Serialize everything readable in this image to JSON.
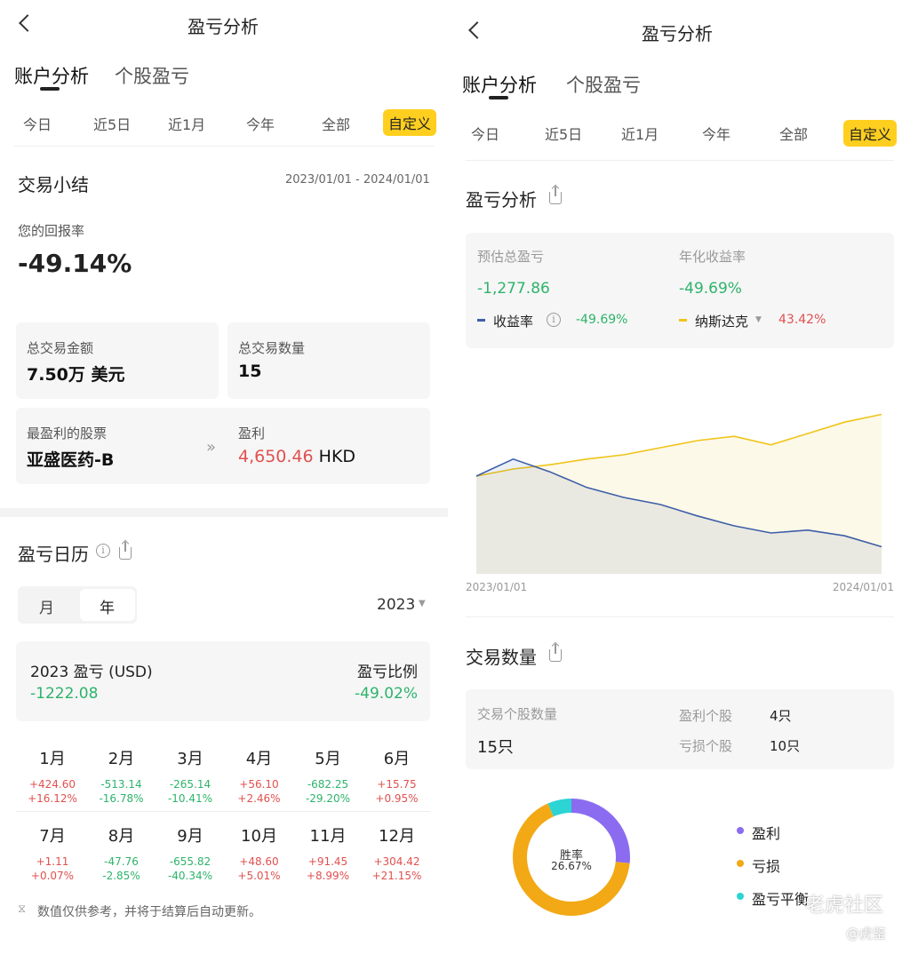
{
  "left": {
    "title": "盈亏分析",
    "tabs": [
      "账户分析",
      "个股盈亏"
    ],
    "periods": [
      "今日",
      "近5日",
      "近1月",
      "今年",
      "全部",
      "自定义"
    ],
    "summary": {
      "heading": "交易小结",
      "date_range": "2023/01/01 - 2024/01/01",
      "return_label": "您的回报率",
      "return_value": "-49.14%",
      "total_amount_label": "总交易金额",
      "total_amount_value": "7.50万 美元",
      "total_count_label": "总交易数量",
      "total_count_value": "15",
      "best_stock_label": "最盈利的股票",
      "best_stock_value": "亚盛医药-B",
      "profit_label": "盈利",
      "profit_value": "4,650.46",
      "profit_currency": "HKD"
    },
    "calendar": {
      "heading": "盈亏日历",
      "mode_month": "月",
      "mode_year": "年",
      "year": "2023",
      "pl_label": "2023 盈亏 (USD)",
      "pl_value": "-1222.08",
      "ratio_label": "盈亏比例",
      "ratio_value": "-49.02%",
      "months": [
        {
          "m": "1月",
          "v1": "+424.60",
          "v2": "+16.12%",
          "c": "red"
        },
        {
          "m": "2月",
          "v1": "-513.14",
          "v2": "-16.78%",
          "c": "green"
        },
        {
          "m": "3月",
          "v1": "-265.14",
          "v2": "-10.41%",
          "c": "green"
        },
        {
          "m": "4月",
          "v1": "+56.10",
          "v2": "+2.46%",
          "c": "red"
        },
        {
          "m": "5月",
          "v1": "-682.25",
          "v2": "-29.20%",
          "c": "green"
        },
        {
          "m": "6月",
          "v1": "+15.75",
          "v2": "+0.95%",
          "c": "red"
        },
        {
          "m": "7月",
          "v1": "+1.11",
          "v2": "+0.07%",
          "c": "red"
        },
        {
          "m": "8月",
          "v1": "-47.76",
          "v2": "-2.85%",
          "c": "green"
        },
        {
          "m": "9月",
          "v1": "-655.82",
          "v2": "-40.34%",
          "c": "green"
        },
        {
          "m": "10月",
          "v1": "+48.60",
          "v2": "+5.01%",
          "c": "red"
        },
        {
          "m": "11月",
          "v1": "+91.45",
          "v2": "+8.99%",
          "c": "red"
        },
        {
          "m": "12月",
          "v1": "+304.42",
          "v2": "+21.15%",
          "c": "red"
        }
      ],
      "note": "数值仅供参考，并将于结算后自动更新。"
    }
  },
  "right": {
    "title": "盈亏分析",
    "tabs": [
      "账户分析",
      "个股盈亏"
    ],
    "periods": [
      "今日",
      "近5日",
      "近1月",
      "今年",
      "全部",
      "自定义"
    ],
    "pl_section": {
      "heading": "盈亏分析",
      "est_label": "预估总盈亏",
      "est_value": "-1,277.86",
      "annual_label": "年化收益率",
      "annual_value": "-49.69%",
      "series1_name": "收益率",
      "series1_value": "-49.69%",
      "series2_name": "纳斯达克",
      "series2_value": "43.42%",
      "x_start": "2023/01/01",
      "x_end": "2024/01/01"
    },
    "trades": {
      "heading": "交易数量",
      "count_label": "交易个股数量",
      "count_value": "15只",
      "profit_label": "盈利个股",
      "profit_value": "4只",
      "loss_label": "亏损个股",
      "loss_value": "10只",
      "donut_label": "胜率",
      "donut_value": "26.67%",
      "legend": [
        "盈利",
        "亏损",
        "盈亏平衡"
      ]
    },
    "watermark": "老虎社区",
    "watermark2": "@虎鉴"
  },
  "colors": {
    "accent_yellow": "#ffcf1f",
    "gain_red": "#e0514f",
    "loss_green": "#2eb36b",
    "series_blue": "#3d5ea8",
    "series_gold": "#f0c419",
    "donut_purple": "#8b6cf0",
    "donut_orange": "#f2a915",
    "donut_cyan": "#2dd4d4"
  },
  "chart_data": {
    "type": "line",
    "x": [
      "2023/01/01",
      "2024/01/01"
    ],
    "series": [
      {
        "name": "收益率",
        "values": [
          0,
          12,
          3,
          -8,
          -15,
          -20,
          -28,
          -35,
          -40,
          -38,
          -42,
          -49.69
        ],
        "color": "#3d5ea8"
      },
      {
        "name": "纳斯达克",
        "values": [
          0,
          5,
          8,
          12,
          15,
          20,
          25,
          28,
          22,
          30,
          38,
          43.42
        ],
        "color": "#f0c419"
      }
    ]
  },
  "donut": {
    "values": [
      4,
      10,
      1
    ]
  }
}
